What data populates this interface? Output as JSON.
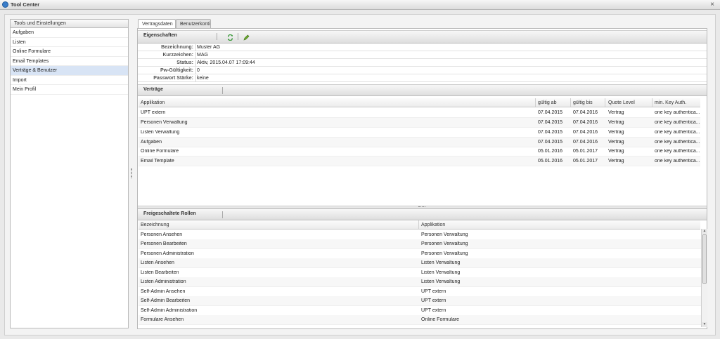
{
  "window": {
    "title": "Tool Center",
    "close_glyph": "×"
  },
  "left_panel": {
    "header": "Tools und Einstellungen",
    "items": [
      "Aufgaben",
      "Listen",
      "Online Formulare",
      "Email Templates",
      "Verträge & Benutzer",
      "Import",
      "Mein Profil"
    ],
    "selected_index": 4
  },
  "tabs": [
    "Vertragsdaten",
    "Benutzerkonti"
  ],
  "active_tab": 0,
  "eigenschaften": {
    "header": "Eigenschaften",
    "toolbar_icons": [
      "refresh-icon",
      "edit-icon"
    ],
    "props": [
      {
        "label": "Bezeichnung:",
        "value": "Muster AG"
      },
      {
        "label": "Kurzzeichen:",
        "value": "MAG"
      },
      {
        "label": "Status:",
        "value": "Aktiv, 2015.04.07 17:09:44"
      },
      {
        "label": "Pw-Gültigkeit:",
        "value": "0"
      },
      {
        "label": "Passwort Stärke:",
        "value": "keine"
      }
    ]
  },
  "vertraege": {
    "header": "Verträge",
    "columns": [
      "Applikation",
      "gültig ab",
      "gültig bis",
      "Quote Level",
      "min. Key Auth."
    ],
    "rows": [
      [
        "UPT extern",
        "07.04.2015",
        "07.04.2016",
        "Vertrag",
        "one key authentica..."
      ],
      [
        "Personen Verwaltung",
        "07.04.2015",
        "07.04.2016",
        "Vertrag",
        "one key authentica..."
      ],
      [
        "Listen Verwaltung",
        "07.04.2015",
        "07.04.2016",
        "Vertrag",
        "one key authentica..."
      ],
      [
        "Aufgaben",
        "07.04.2015",
        "07.04.2016",
        "Vertrag",
        "one key authentica..."
      ],
      [
        "Online Formulare",
        "05.01.2016",
        "05.01.2017",
        "Vertrag",
        "one key authentica..."
      ],
      [
        "Email Template",
        "05.01.2016",
        "05.01.2017",
        "Vertrag",
        "one key authentica..."
      ]
    ]
  },
  "rollen": {
    "header": "Freigeschaltete Rollen",
    "columns": [
      "Bezeichnung",
      "Applikation"
    ],
    "rows": [
      [
        "Personen Ansehen",
        "Personen Verwaltung"
      ],
      [
        "Personen Bearbeiten",
        "Personen Verwaltung"
      ],
      [
        "Personen Administration",
        "Personen Verwaltung"
      ],
      [
        "Listen Ansehen",
        "Listen Verwaltung"
      ],
      [
        "Listen Bearbeiten",
        "Listen Verwaltung"
      ],
      [
        "Listen Administration",
        "Listen Verwaltung"
      ],
      [
        "Self-Admin Ansehen",
        "UPT extern"
      ],
      [
        "Self-Admin Bearbeiten",
        "UPT extern"
      ],
      [
        "Self-Admin Administration",
        "UPT extern"
      ],
      [
        "Formulare Ansehen",
        "Online Formulare"
      ]
    ]
  },
  "colors": {
    "selection": "#d8e4f5",
    "accent_icon": "#3a7dc9",
    "refresh_icon": "#3c9a3c",
    "edit_icon": "#6aa82c"
  }
}
